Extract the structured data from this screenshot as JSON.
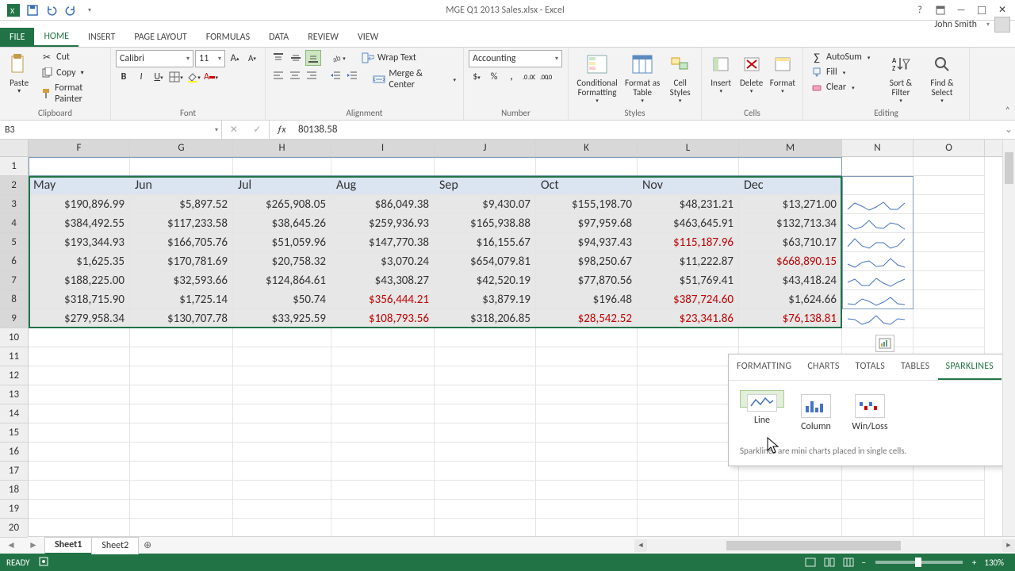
{
  "app": {
    "title": "MGE Q1 2013 Sales.xlsx - Excel",
    "user": "John Smith"
  },
  "tabs": {
    "file": "FILE",
    "items": [
      "HOME",
      "INSERT",
      "PAGE LAYOUT",
      "FORMULAS",
      "DATA",
      "REVIEW",
      "VIEW"
    ],
    "active": 0
  },
  "ribbon": {
    "clipboard": {
      "label": "Clipboard",
      "paste": "Paste",
      "cut": "Cut",
      "copy": "Copy",
      "fp": "Format Painter"
    },
    "font": {
      "label": "Font",
      "name": "Calibri",
      "size": "11"
    },
    "alignment": {
      "label": "Alignment",
      "wrap": "Wrap Text",
      "merge": "Merge & Center"
    },
    "number": {
      "label": "Number",
      "format": "Accounting"
    },
    "styles": {
      "label": "Styles",
      "cf": "Conditional Formatting",
      "fat": "Format as Table",
      "cs": "Cell Styles"
    },
    "cells": {
      "label": "Cells",
      "insert": "Insert",
      "delete": "Delete",
      "format": "Format"
    },
    "editing": {
      "label": "Editing",
      "autosum": "AutoSum",
      "fill": "Fill",
      "clear": "Clear",
      "sort": "Sort & Filter",
      "find": "Find & Select"
    }
  },
  "fx": {
    "name_box": "B3",
    "formula": "80138.58"
  },
  "grid": {
    "cols": [
      "F",
      "G",
      "H",
      "I",
      "J",
      "K",
      "L",
      "M",
      "N",
      "O"
    ],
    "row_nums": [
      1,
      2,
      3,
      4,
      5,
      6,
      7,
      8,
      9,
      10,
      11,
      12,
      13,
      14,
      15,
      16,
      17,
      18,
      19,
      20
    ],
    "months": [
      "May",
      "Jun",
      "Jul",
      "Aug",
      "Sep",
      "Oct",
      "Nov",
      "Dec"
    ]
  },
  "chart_data": {
    "type": "table",
    "columns": [
      "May",
      "Jun",
      "Jul",
      "Aug",
      "Sep",
      "Oct",
      "Nov",
      "Dec"
    ],
    "rows": [
      [
        190896.99,
        5897.52,
        265908.05,
        86049.38,
        9430.07,
        155198.7,
        48231.21,
        13271.0
      ],
      [
        384492.55,
        117233.58,
        38645.26,
        259936.93,
        165938.88,
        97959.68,
        463645.91,
        132713.34
      ],
      [
        193344.93,
        166705.76,
        51059.96,
        147770.38,
        16155.67,
        94937.43,
        115187.96,
        63710.17
      ],
      [
        1625.35,
        170781.69,
        20758.32,
        3070.24,
        654079.81,
        98250.67,
        11222.87,
        668890.15
      ],
      [
        188225.0,
        32593.66,
        124864.61,
        43308.27,
        42520.19,
        77870.56,
        51769.41,
        43418.24
      ],
      [
        318715.9,
        1725.14,
        50.74,
        356444.21,
        3879.19,
        196.48,
        387724.6,
        1624.66
      ],
      [
        279958.34,
        130707.78,
        33925.59,
        108793.56,
        318206.85,
        28542.52,
        23341.86,
        76138.81
      ]
    ],
    "red_cells": [
      [
        2,
        6
      ],
      [
        3,
        7
      ],
      [
        5,
        3
      ],
      [
        5,
        6
      ],
      [
        6,
        3
      ],
      [
        6,
        5
      ],
      [
        6,
        6
      ],
      [
        6,
        7
      ]
    ]
  },
  "table_fmt": [
    [
      "$190,896.99",
      "$5,897.52",
      "$265,908.05",
      "$86,049.38",
      "$9,430.07",
      "$155,198.70",
      "$48,231.21",
      "$13,271.00"
    ],
    [
      "$384,492.55",
      "$117,233.58",
      "$38,645.26",
      "$259,936.93",
      "$165,938.88",
      "$97,959.68",
      "$463,645.91",
      "$132,713.34"
    ],
    [
      "$193,344.93",
      "$166,705.76",
      "$51,059.96",
      "$147,770.38",
      "$16,155.67",
      "$94,937.43",
      "$115,187.96",
      "$63,710.17"
    ],
    [
      "$1,625.35",
      "$170,781.69",
      "$20,758.32",
      "$3,070.24",
      "$654,079.81",
      "$98,250.67",
      "$11,222.87",
      "$668,890.15"
    ],
    [
      "$188,225.00",
      "$32,593.66",
      "$124,864.61",
      "$43,308.27",
      "$42,520.19",
      "$77,870.56",
      "$51,769.41",
      "$43,418.24"
    ],
    [
      "$318,715.90",
      "$1,725.14",
      "$50.74",
      "$356,444.21",
      "$3,879.19",
      "$196.48",
      "$387,724.60",
      "$1,624.66"
    ],
    [
      "$279,958.34",
      "$130,707.78",
      "$33,925.59",
      "$108,793.56",
      "$318,206.85",
      "$28,542.52",
      "$23,341.86",
      "$76,138.81"
    ]
  ],
  "qa": {
    "tabs": [
      "FORMATTING",
      "CHARTS",
      "TOTALS",
      "TABLES",
      "SPARKLINES"
    ],
    "active": 4,
    "opts": [
      "Line",
      "Column",
      "Win/Loss"
    ],
    "sel": 0,
    "desc": "Sparklines are mini charts placed in single cells."
  },
  "sheets": {
    "items": [
      "Sheet1",
      "Sheet2"
    ],
    "active": 0
  },
  "status": {
    "ready": "READY",
    "zoom": "130%"
  }
}
